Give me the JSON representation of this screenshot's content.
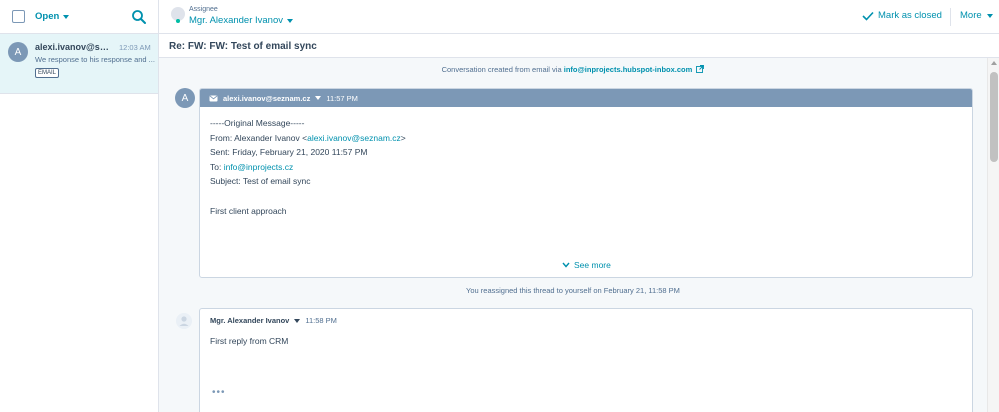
{
  "sidebar": {
    "filter_label": "Open",
    "conversation": {
      "avatar_initial": "A",
      "from": "alexi.ivanov@seznam.cz",
      "time": "12:03 AM",
      "preview": "We response to his response and ...",
      "badge": "EMAIL"
    }
  },
  "header": {
    "assignee_label": "Assignee",
    "assignee_name": "Mgr. Alexander Ivanov",
    "mark_closed_label": "Mark as closed",
    "more_label": "More"
  },
  "subject": "Re: FW: FW: Test of email sync",
  "thread": {
    "created_prefix": "Conversation created from email via ",
    "created_email": "info@inprojects.hubspot-inbox.com",
    "email_message": {
      "avatar_initial": "A",
      "from": "alexi.ivanov@seznam.cz",
      "time": "11:57 PM",
      "original_message": "-----Original Message-----",
      "from_line_prefix": "From: Alexander Ivanov <",
      "from_line_email": "alexi.ivanov@seznam.cz",
      "from_line_suffix": ">",
      "sent_line": "Sent: Friday, February 21, 2020 11:57 PM",
      "to_line_prefix": "To: ",
      "to_line_email": "info@inprojects.cz",
      "subject_line": "Subject: Test of email sync",
      "body": "First client approach",
      "see_more_label": "See more"
    },
    "reassigned_text": "You reassigned this thread to yourself on February 21, 11:58 PM",
    "reply": {
      "name": "Mgr. Alexander Ivanov",
      "time": "11:58 PM",
      "body": "First reply from CRM",
      "dots": "•••"
    }
  },
  "colors": {
    "accent": "#0091ae",
    "text": "#33475b",
    "muted": "#516f90",
    "email_header": "#7c98b6",
    "selected_bg": "#e5f5f8"
  }
}
